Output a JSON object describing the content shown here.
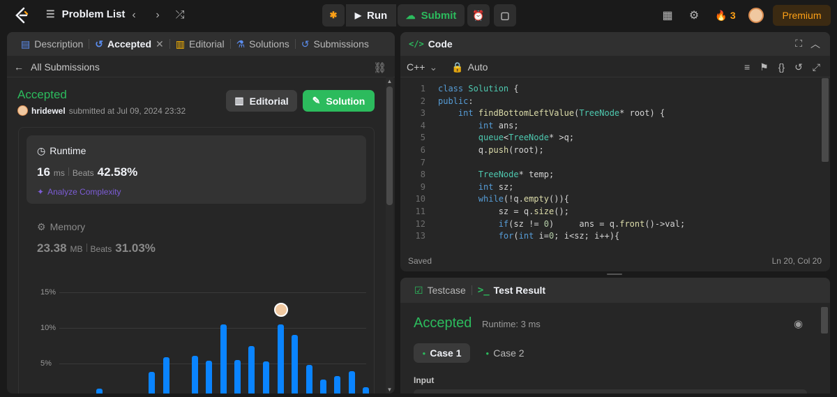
{
  "topbar": {
    "problem_list": "Problem List",
    "run": "Run",
    "submit": "Submit",
    "streak": "3",
    "premium": "Premium"
  },
  "left_tabs": [
    {
      "label": "Description",
      "active": false
    },
    {
      "label": "Accepted",
      "active": true
    },
    {
      "label": "Editorial",
      "active": false
    },
    {
      "label": "Solutions",
      "active": false
    },
    {
      "label": "Submissions",
      "active": false
    }
  ],
  "submission": {
    "back_label": "All Submissions",
    "status": "Accepted",
    "user": "hridewel",
    "submitted_text": "submitted at Jul 09, 2024 23:32",
    "editorial_btn": "Editorial",
    "solution_btn": "Solution",
    "runtime_title": "Runtime",
    "runtime_value": "16",
    "runtime_unit": "ms",
    "beats_label": "Beats",
    "runtime_beats": "42.58%",
    "analyze": "Analyze Complexity",
    "memory_title": "Memory",
    "memory_value": "23.38",
    "memory_unit": "MB",
    "memory_beats": "31.03%"
  },
  "chart_data": {
    "type": "bar",
    "y_ticks": [
      "15%",
      "10%",
      "5%"
    ],
    "ylim": [
      0,
      15
    ],
    "values": [
      1.5,
      0.4,
      3.8,
      5.9,
      0.6,
      6.1,
      5.4,
      10.5,
      5.5,
      7.5,
      5.3,
      10.5,
      9.0,
      4.8,
      2.7,
      3.2,
      3.9,
      1.7
    ],
    "highlight_index": 11
  },
  "code": {
    "title": "Code",
    "language": "C++",
    "mode": "Auto",
    "status": "Saved",
    "position": "Ln 20, Col 20",
    "lines": [
      "class Solution {",
      "public:",
      "    int findBottomLeftValue(TreeNode* root) {",
      "        int ans;",
      "        queue<TreeNode* >q;",
      "        q.push(root);",
      "",
      "        TreeNode* temp;",
      "        int sz;",
      "        while(!q.empty()){",
      "            sz = q.size();",
      "            if(sz != 0)     ans = q.front()->val;",
      "            for(int i=0; i<sz; i++){"
    ]
  },
  "result": {
    "testcase_tab": "Testcase",
    "result_tab": "Test Result",
    "status": "Accepted",
    "runtime": "Runtime: 3 ms",
    "case1": "Case 1",
    "case2": "Case 2",
    "input_label": "Input"
  }
}
